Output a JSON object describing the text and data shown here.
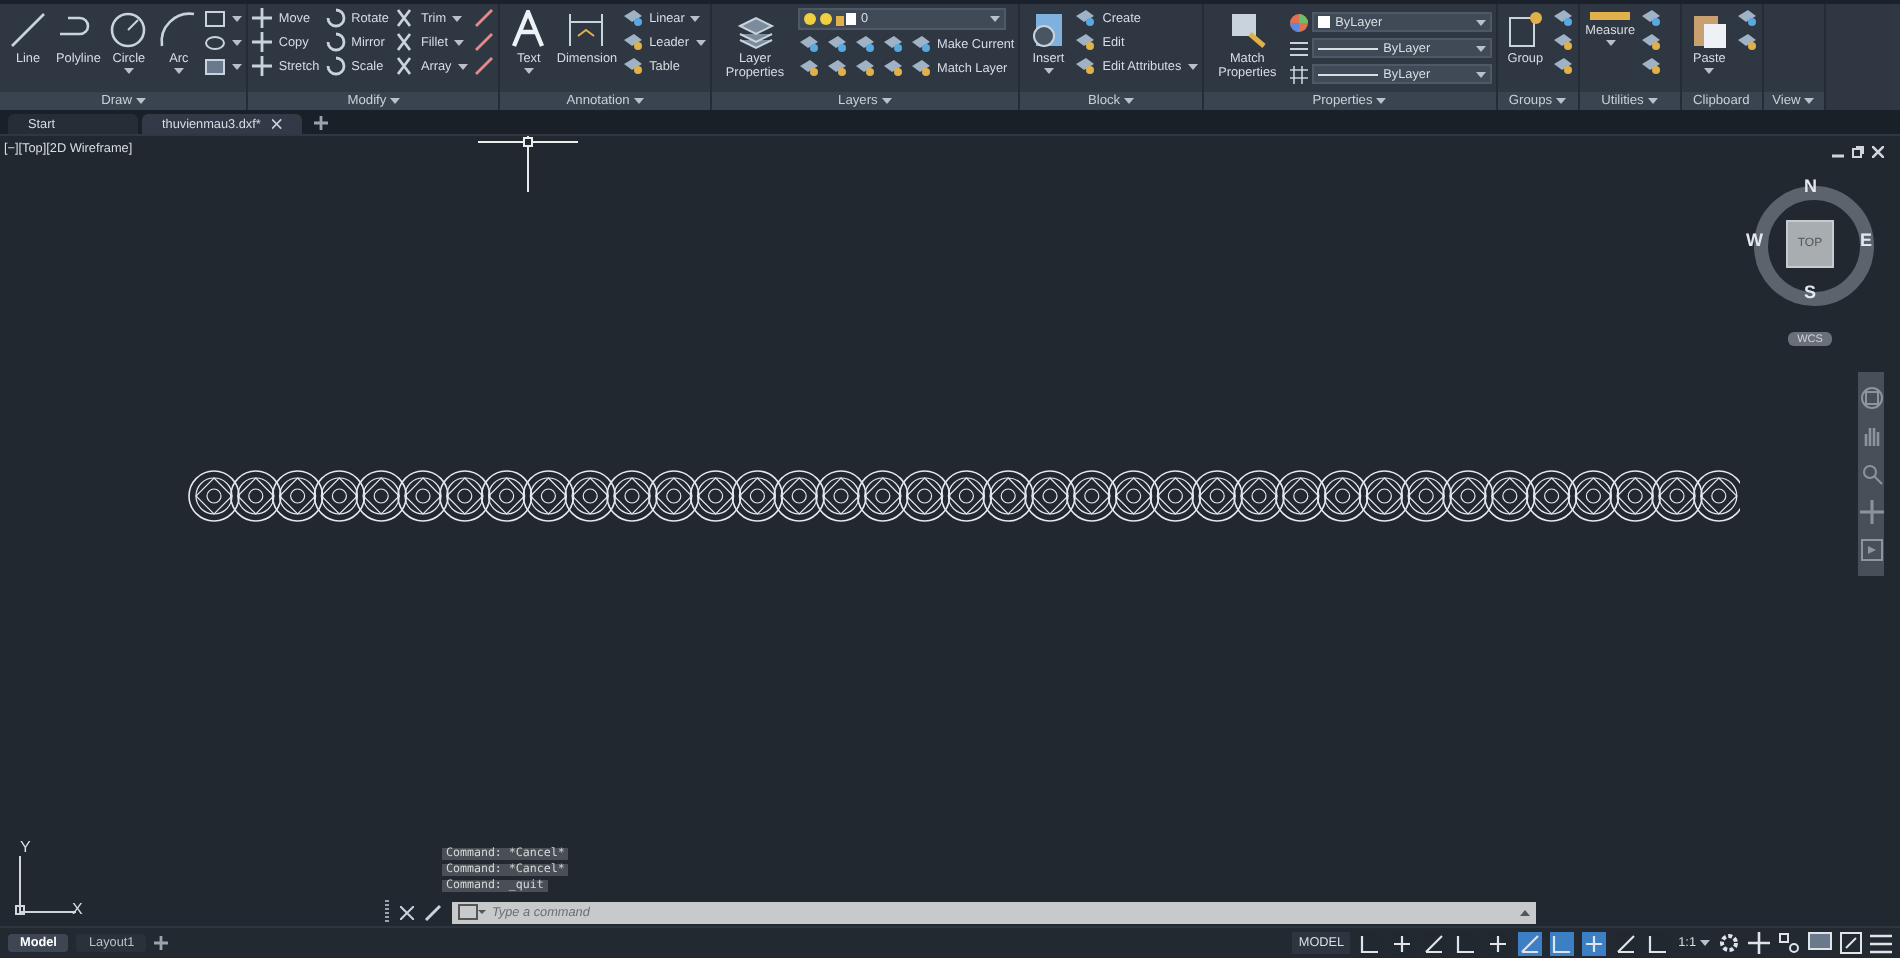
{
  "ribbon": {
    "panels": [
      {
        "title": "Draw",
        "has_menu": true,
        "large_tools": [
          {
            "label": "Line",
            "has_menu": false
          },
          {
            "label": "Polyline",
            "has_menu": false
          },
          {
            "label": "Circle",
            "has_menu": true
          },
          {
            "label": "Arc",
            "has_menu": true
          }
        ],
        "columns": [
          [
            {
              "has_menu": true
            },
            {
              "has_menu": true
            },
            {
              "has_menu": true
            }
          ]
        ]
      },
      {
        "title": "Modify",
        "has_menu": true,
        "columns": [
          [
            {
              "label": "Move",
              "has_menu": false
            },
            {
              "label": "Copy",
              "has_menu": false
            },
            {
              "label": "Stretch",
              "has_menu": false
            }
          ],
          [
            {
              "label": "Rotate",
              "has_menu": false
            },
            {
              "label": "Mirror",
              "has_menu": false
            },
            {
              "label": "Scale",
              "has_menu": false
            }
          ],
          [
            {
              "label": "Trim",
              "has_menu": true
            },
            {
              "label": "Fillet",
              "has_menu": true
            },
            {
              "label": "Array",
              "has_menu": true
            }
          ],
          [
            {
              "has_menu": false
            },
            {
              "has_menu": false
            },
            {
              "has_menu": false
            }
          ]
        ]
      },
      {
        "title": "Annotation",
        "has_menu": true,
        "large_tools": [
          {
            "label": "Text",
            "has_menu": true
          },
          {
            "label": "Dimension",
            "has_menu": false
          }
        ],
        "columns": [
          [
            {
              "label": "Linear",
              "has_menu": true
            },
            {
              "label": "Leader",
              "has_menu": true
            },
            {
              "label": "Table",
              "has_menu": false
            }
          ]
        ]
      },
      {
        "title": "Layers",
        "has_menu": true,
        "large_tools": [
          {
            "label": "Layer Properties",
            "has_menu": false
          }
        ],
        "layer_dropdown": {
          "value": "0"
        },
        "columns": [
          [
            {
              "has_menu": false
            },
            {
              "has_menu": false
            }
          ],
          [
            {
              "has_menu": false
            },
            {
              "has_menu": false
            }
          ],
          [
            {
              "has_menu": false
            },
            {
              "has_menu": false
            }
          ],
          [
            {
              "has_menu": false
            },
            {
              "has_menu": false
            }
          ],
          [
            {
              "label": "Make Current",
              "has_menu": false
            },
            {
              "label": "Match Layer",
              "has_menu": false
            }
          ]
        ]
      },
      {
        "title": "Block",
        "has_menu": true,
        "large_tools": [
          {
            "label": "Insert",
            "has_menu": true
          }
        ],
        "columns": [
          [
            {
              "label": "Create",
              "has_menu": false
            },
            {
              "label": "Edit",
              "has_menu": false
            },
            {
              "label": "Edit Attributes",
              "has_menu": true
            }
          ]
        ]
      },
      {
        "title": "Properties",
        "has_menu": true,
        "large_tools": [
          {
            "label": "Match Properties",
            "has_menu": false
          }
        ],
        "property_dropdowns": [
          {
            "kind": "color",
            "value": "ByLayer"
          },
          {
            "kind": "linetype",
            "value": "ByLayer"
          },
          {
            "kind": "lineweight",
            "value": "ByLayer"
          }
        ]
      },
      {
        "title": "Groups",
        "has_menu": true,
        "large_tools": [
          {
            "label": "Group",
            "has_menu": false
          }
        ],
        "columns": [
          [
            {
              "has_menu": false
            },
            {
              "has_menu": false
            },
            {
              "has_menu": false
            }
          ]
        ]
      },
      {
        "title": "Utilities",
        "has_menu": true,
        "large_tools": [
          {
            "label": "Measure",
            "has_menu": true
          }
        ],
        "columns": [
          [
            {
              "has_menu": false
            },
            {
              "has_menu": false
            },
            {
              "has_menu": false
            }
          ]
        ]
      },
      {
        "title": "Clipboard",
        "has_menu": false,
        "large_tools": [
          {
            "label": "Paste",
            "has_menu": true
          }
        ],
        "columns": [
          [
            {
              "has_menu": false
            },
            {
              "has_menu": false
            }
          ]
        ]
      },
      {
        "title": "View",
        "has_menu": true
      }
    ]
  },
  "document_tabs": [
    {
      "label": "Start",
      "selected": false,
      "closable": false
    },
    {
      "label": "thuvienmau3.dxf*",
      "selected": true,
      "closable": true
    }
  ],
  "viewport": {
    "label": "[−][Top][2D Wireframe]",
    "viewcube": {
      "face": "TOP",
      "north": "N",
      "south": "S",
      "east": "E",
      "west": "W",
      "ucs": "WCS"
    },
    "ucs_icon": {
      "x": "X",
      "y": "Y"
    }
  },
  "command_line": {
    "history": [
      "Command: *Cancel*",
      "Command: *Cancel*",
      "Command: _quit"
    ],
    "placeholder": "Type a command"
  },
  "layout_tabs": [
    {
      "label": "Model",
      "selected": true
    },
    {
      "label": "Layout1",
      "selected": false
    }
  ],
  "status_bar": {
    "space": "MODEL",
    "scale": "1:1",
    "toggles": [
      {
        "on": false
      },
      {
        "on": false
      },
      {
        "on": false
      },
      {
        "on": false
      },
      {
        "on": false
      },
      {
        "on": true
      },
      {
        "on": true
      },
      {
        "on": true
      },
      {
        "on": false
      },
      {
        "on": false
      }
    ]
  }
}
